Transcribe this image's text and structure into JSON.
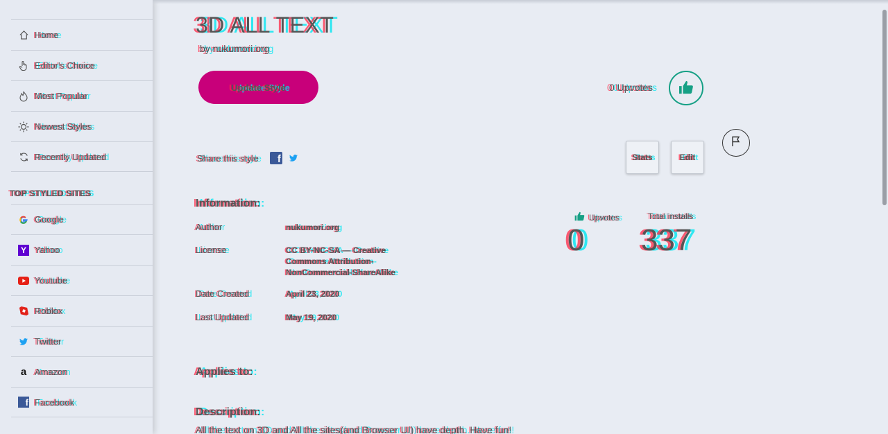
{
  "sidebar": {
    "nav": [
      {
        "label": "Home",
        "icon": "home-icon"
      },
      {
        "label": "Editor's Choice",
        "icon": "hand-pointer-icon"
      },
      {
        "label": "Most Popular",
        "icon": "flame-icon"
      },
      {
        "label": "Newest Styles",
        "icon": "sun-icon"
      },
      {
        "label": "Recently Updated",
        "icon": "refresh-icon"
      }
    ],
    "heading": "TOP STYLED SITES",
    "sites": [
      {
        "label": "Google",
        "icon": "google-icon"
      },
      {
        "label": "Yahoo",
        "icon": "yahoo-icon"
      },
      {
        "label": "Youtube",
        "icon": "youtube-icon"
      },
      {
        "label": "Roblox",
        "icon": "roblox-icon"
      },
      {
        "label": "Twitter",
        "icon": "twitter-icon"
      },
      {
        "label": "Amazon",
        "icon": "amazon-icon"
      },
      {
        "label": "Facebook",
        "icon": "facebook-icon"
      }
    ]
  },
  "style": {
    "title": "3D ALL TEXT",
    "author_host": "by nukumori.org",
    "update_button": "Update Style",
    "upvotes_text": "0 Upvotes",
    "share_label": "Share this style",
    "stats_button": "Stats",
    "edit_button": "Edit"
  },
  "information": {
    "heading": "Information:",
    "rows": [
      {
        "label": "Author",
        "value": "nukumori.org"
      },
      {
        "label": "License",
        "value": "CC BY-NC-SA — Creative Commons Attribution-NonCommercial-ShareAlike"
      },
      {
        "label": "Date Created",
        "value": "April 23, 2020"
      },
      {
        "label": "Last Updated",
        "value": "May 19, 2020"
      }
    ]
  },
  "stats": {
    "upvotes_label": "Upvotes",
    "upvotes_value": "0",
    "installs_label": "Total installs",
    "installs_value": "337"
  },
  "applies_to": {
    "heading": "Applies to:"
  },
  "description": {
    "heading": "Description:",
    "text": "All the text on 3D and All the sites(and Browser UI) have depth. Have fun!"
  },
  "colors": {
    "accent": "#c8007a",
    "like": "#16a085",
    "facebook": "#3b5998",
    "twitter": "#1da1f2"
  }
}
